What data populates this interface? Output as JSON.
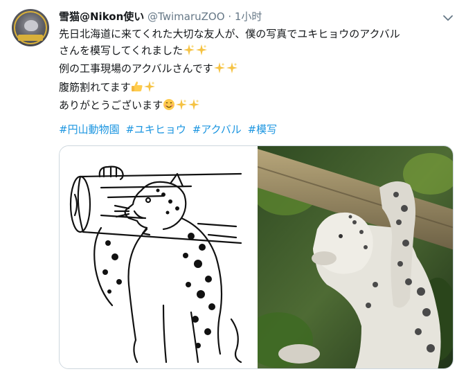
{
  "user": {
    "display_name": "雪猫@Nikon使い",
    "handle": "@TwimaruZOO",
    "separator": "·",
    "time": "1小时"
  },
  "tweet": {
    "lines": [
      {
        "text": "先日北海道に来てくれた大切な友人が、僕の写真でユキヒョウのアクバル",
        "emoji": []
      },
      {
        "text": "さんを模写してくれました",
        "emoji": [
          "sparkles-icon",
          "sparkles-icon"
        ]
      },
      {
        "text": "例の工事現場のアクバルさんです",
        "emoji": [
          "sparkles-icon",
          "sparkles-icon"
        ]
      },
      {
        "text": "腹筋割れてます",
        "emoji": [
          "thumbs-up-icon",
          "sparkles-icon"
        ]
      },
      {
        "text": "ありがとうございます",
        "emoji": [
          "smiling-face-icon",
          "sparkles-icon",
          "sparkles-icon"
        ]
      }
    ],
    "hashtags": [
      "#円山動物園",
      "#ユキヒョウ",
      "#アクバル",
      "#模写"
    ]
  },
  "media": {
    "items": [
      "snow-leopard-line-drawing",
      "snow-leopard-photo"
    ]
  },
  "colors": {
    "link": "#1b95e0",
    "secondary": "#657786",
    "text": "#14171a",
    "border": "#ccd6dd"
  }
}
